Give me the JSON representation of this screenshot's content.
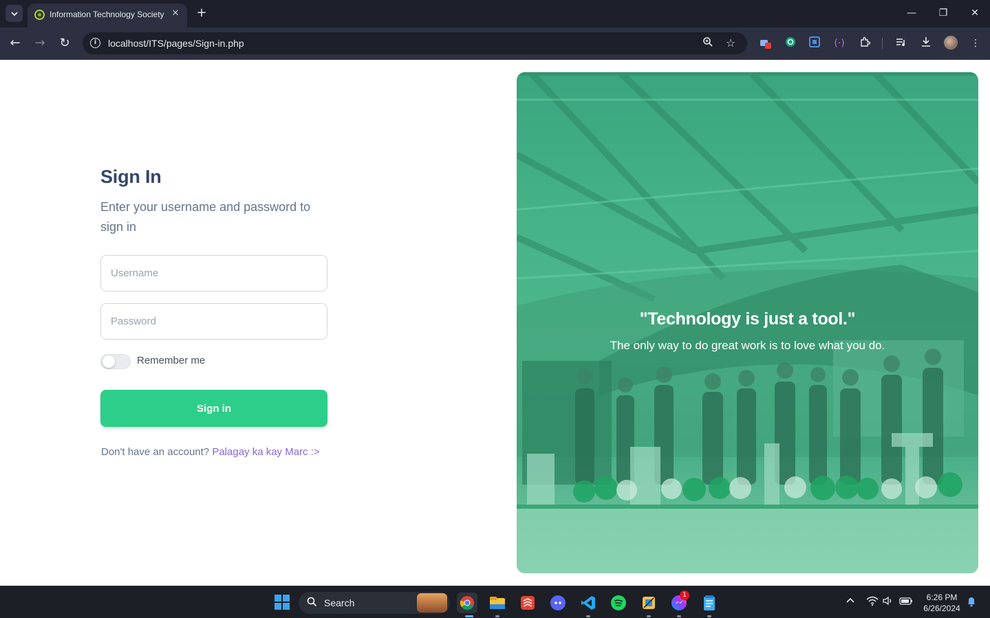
{
  "browser": {
    "tab_title": "Information Technology Society",
    "close_tab": "✕",
    "new_tab": "+",
    "url": "localhost/ITS/pages/Sign-in.php"
  },
  "signin": {
    "heading": "Sign In",
    "subtitle": "Enter your username and password to sign in",
    "username_placeholder": "Username",
    "password_placeholder": "Password",
    "remember_label": "Remember me",
    "remember_checked": false,
    "button_label": "Sign in",
    "no_account_text": "Don't have an account?",
    "register_link": "Palagay ka kay Marc :>"
  },
  "hero": {
    "quote": "\"Technology is just a tool.\"",
    "caption": "The only way to do great work is to love what you do."
  },
  "taskbar": {
    "search_label": "Search",
    "time": "6:26 PM",
    "date": "6/26/2024",
    "messenger_badge": "1"
  },
  "colors": {
    "primary_green": "#2dce89",
    "heading": "#344767",
    "link": "#8768d8",
    "overlay": "#46b388"
  }
}
